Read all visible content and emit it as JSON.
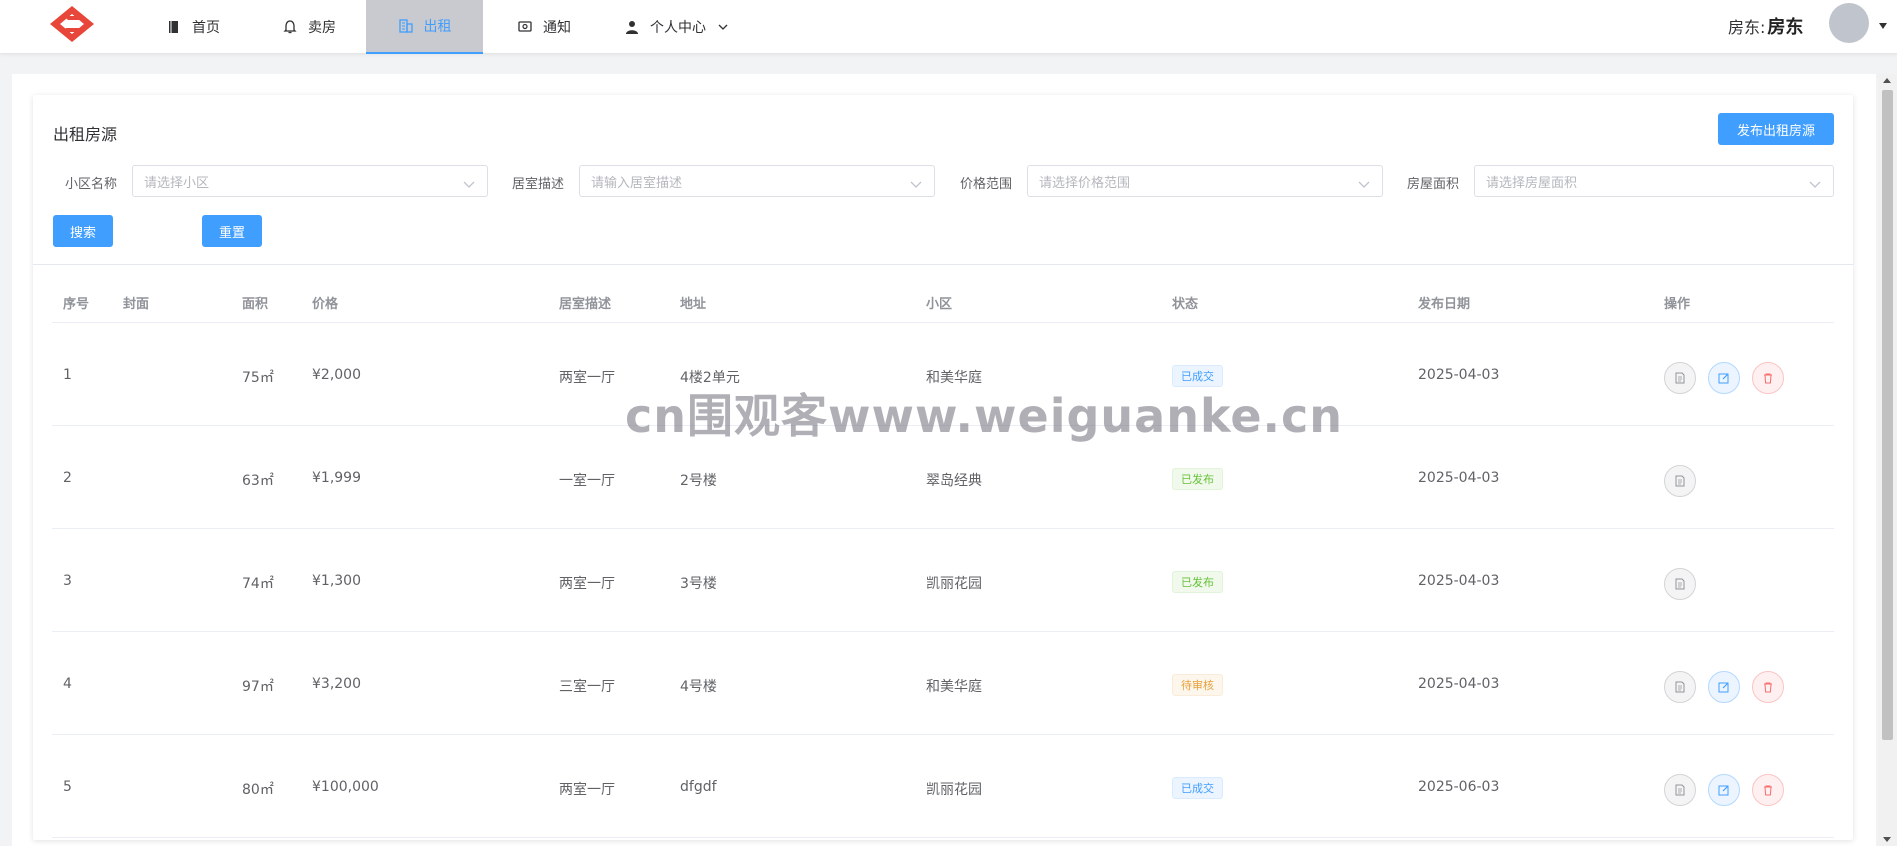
{
  "nav": {
    "items": [
      {
        "label": "首页",
        "icon": "book-icon"
      },
      {
        "label": "卖房",
        "icon": "bell-icon"
      },
      {
        "label": "出租",
        "icon": "building-icon",
        "active": true
      },
      {
        "label": "通知",
        "icon": "message-icon"
      },
      {
        "label": "个人中心",
        "icon": "user-icon"
      }
    ],
    "landlord_prefix": "房东:",
    "landlord_name": "房东",
    "active_color": "#409eff",
    "brand_color": "#e8463a"
  },
  "page": {
    "title": "出租房源",
    "publish_label": "发布出租房源"
  },
  "filters": {
    "community": {
      "label": "小区名称",
      "placeholder": "请选择小区"
    },
    "room": {
      "label": "居室描述",
      "placeholder": "请输入居室描述"
    },
    "price": {
      "label": "价格范围",
      "placeholder": "请选择价格范围"
    },
    "area": {
      "label": "房屋面积",
      "placeholder": "请选择房屋面积"
    },
    "search_label": "搜索",
    "reset_label": "重置"
  },
  "table": {
    "headers": {
      "no": "序号",
      "cover": "封面",
      "area": "面积",
      "price": "价格",
      "room": "居室描述",
      "addr": "地址",
      "community": "小区",
      "status": "状态",
      "date": "发布日期",
      "ops": "操作"
    },
    "rows": [
      {
        "no": "1",
        "area": "75㎡",
        "price": "¥2,000",
        "room": "两室一厅",
        "addr": "4楼2单元",
        "community": "和美华庭",
        "status": "已成交",
        "status_color": "blue",
        "date": "2025-04-03",
        "ops": [
          "view",
          "edit",
          "delete"
        ]
      },
      {
        "no": "2",
        "area": "63㎡",
        "price": "¥1,999",
        "room": "一室一厅",
        "addr": "2号楼",
        "community": "翠岛经典",
        "status": "已发布",
        "status_color": "green",
        "date": "2025-04-03",
        "ops": [
          "view"
        ]
      },
      {
        "no": "3",
        "area": "74㎡",
        "price": "¥1,300",
        "room": "两室一厅",
        "addr": "3号楼",
        "community": "凯丽花园",
        "status": "已发布",
        "status_color": "green",
        "date": "2025-04-03",
        "ops": [
          "view"
        ]
      },
      {
        "no": "4",
        "area": "97㎡",
        "price": "¥3,200",
        "room": "三室一厅",
        "addr": "4号楼",
        "community": "和美华庭",
        "status": "待审核",
        "status_color": "orange",
        "date": "2025-04-03",
        "ops": [
          "view",
          "edit",
          "delete"
        ]
      },
      {
        "no": "5",
        "area": "80㎡",
        "price": "¥100,000",
        "room": "两室一厅",
        "addr": "dfgdf",
        "community": "凯丽花园",
        "status": "已成交",
        "status_color": "blue",
        "date": "2025-06-03",
        "ops": [
          "view",
          "edit",
          "delete"
        ]
      }
    ]
  },
  "watermark": "cn围观客www.weiguanke.cn"
}
